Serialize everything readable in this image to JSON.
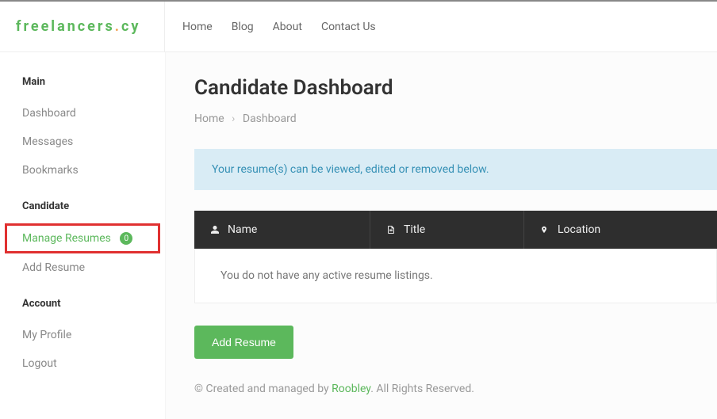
{
  "logo": {
    "word1": "freelancers",
    "dot": ".",
    "word2": "cy"
  },
  "nav": {
    "home": "Home",
    "blog": "Blog",
    "about": "About",
    "contact": "Contact Us"
  },
  "sidebar": {
    "section_main": "Main",
    "section_candidate": "Candidate",
    "section_account": "Account",
    "dashboard": "Dashboard",
    "messages": "Messages",
    "bookmarks": "Bookmarks",
    "manage_resumes": "Manage Resumes",
    "manage_resumes_count": "0",
    "add_resume": "Add Resume",
    "my_profile": "My Profile",
    "logout": "Logout"
  },
  "page": {
    "title": "Candidate Dashboard",
    "breadcrumb_home": "Home",
    "breadcrumb_current": "Dashboard"
  },
  "banner": {
    "text": "Your resume(s) can be viewed, edited or removed below."
  },
  "table": {
    "col_name": "Name",
    "col_title": "Title",
    "col_location": "Location",
    "empty_text": "You do not have any active resume listings."
  },
  "actions": {
    "add_resume_btn": "Add Resume"
  },
  "footer": {
    "prefix": "© Created and managed by ",
    "link": "Roobley",
    "suffix": ". All Rights Reserved."
  }
}
